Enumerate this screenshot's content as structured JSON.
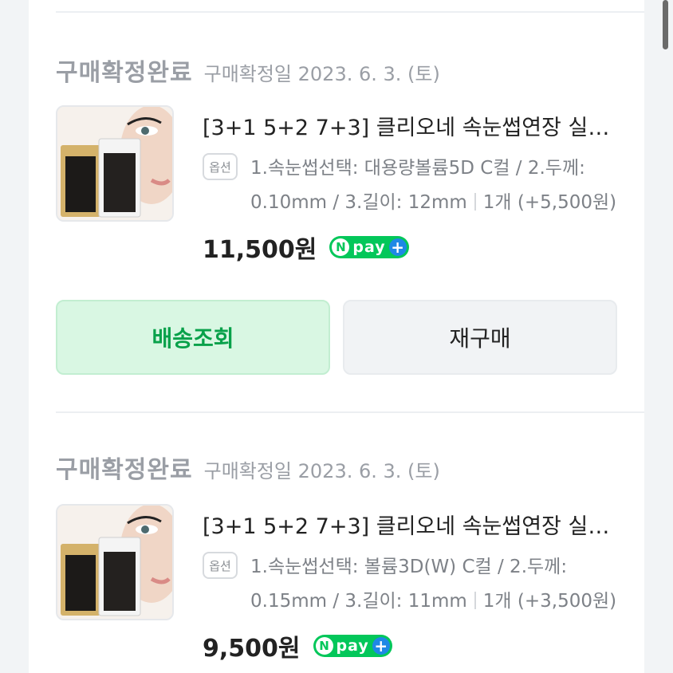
{
  "orders": [
    {
      "status": "구매확정완료",
      "date": "구매확정일 2023. 6. 3. (토)",
      "title": "[3+1 5+2 7+3] 클리오네 속눈썹연장 실크…",
      "option_badge": "옵션",
      "option_main": "1.속눈썹선택: 대용량볼륨5D C컬 / 2.두께: 0.10mm / 3.길이: 12mm",
      "option_qty": "1개 (+5,500원)",
      "price": "11,500원",
      "npay_n": "N",
      "npay_label": "pay",
      "npay_plus": "+",
      "buttons": {
        "track": "배송조회",
        "rebuy": "재구매"
      }
    },
    {
      "status": "구매확정완료",
      "date": "구매확정일 2023. 6. 3. (토)",
      "title": "[3+1 5+2 7+3] 클리오네 속눈썹연장 실크…",
      "option_badge": "옵션",
      "option_main": "1.속눈썹선택: 볼륨3D(W) C컬 / 2.두께: 0.15mm / 3.길이: 11mm",
      "option_qty": "1개 (+3,500원)",
      "price": "9,500원",
      "npay_n": "N",
      "npay_label": "pay",
      "npay_plus": "+"
    }
  ],
  "colors": {
    "npay_green": "#03c75a",
    "track_button_text": "#08a14a",
    "track_button_bg": "#d9f7e3"
  }
}
